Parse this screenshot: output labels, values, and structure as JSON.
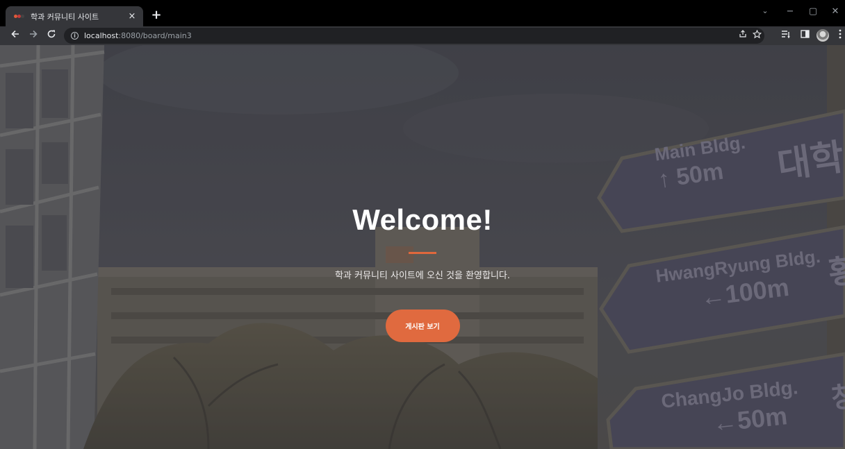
{
  "browser": {
    "tab_title": "학과 커뮤니티 사이트",
    "tab_close": "×",
    "new_tab": "+",
    "url_host": "localhost",
    "url_rest": ":8080/board/main3",
    "window_controls": {
      "chevron": "⌄",
      "minimize": "−",
      "maximize": "▢",
      "close": "✕"
    },
    "icons": [
      "back-arrow-icon",
      "forward-arrow-icon",
      "reload-icon",
      "info-icon",
      "share-icon",
      "star-icon",
      "reading-list-icon",
      "side-panel-icon",
      "profile-avatar",
      "menu-kebab-icon"
    ]
  },
  "background": {
    "signs": [
      {
        "line1": "Main Bldg.",
        "line2": "↑ 50m",
        "hangul": "대학"
      },
      {
        "line1": "HwangRyung Bldg.",
        "line2": "←100m",
        "hangul": "황"
      },
      {
        "line1": "ChangJo Bldg.",
        "line2": "←50m",
        "hangul": "창"
      }
    ]
  },
  "hero": {
    "title": "Welcome!",
    "subtitle": "학과 커뮤니티 사이트에 오신 것을 환영합니다.",
    "button_label": "게시판 보기"
  },
  "colors": {
    "accent": "#e06a3f",
    "divider": "#e0683c",
    "chrome_dark": "#000000",
    "chrome_toolbar": "#35363a",
    "sign_fill": "#575569"
  }
}
